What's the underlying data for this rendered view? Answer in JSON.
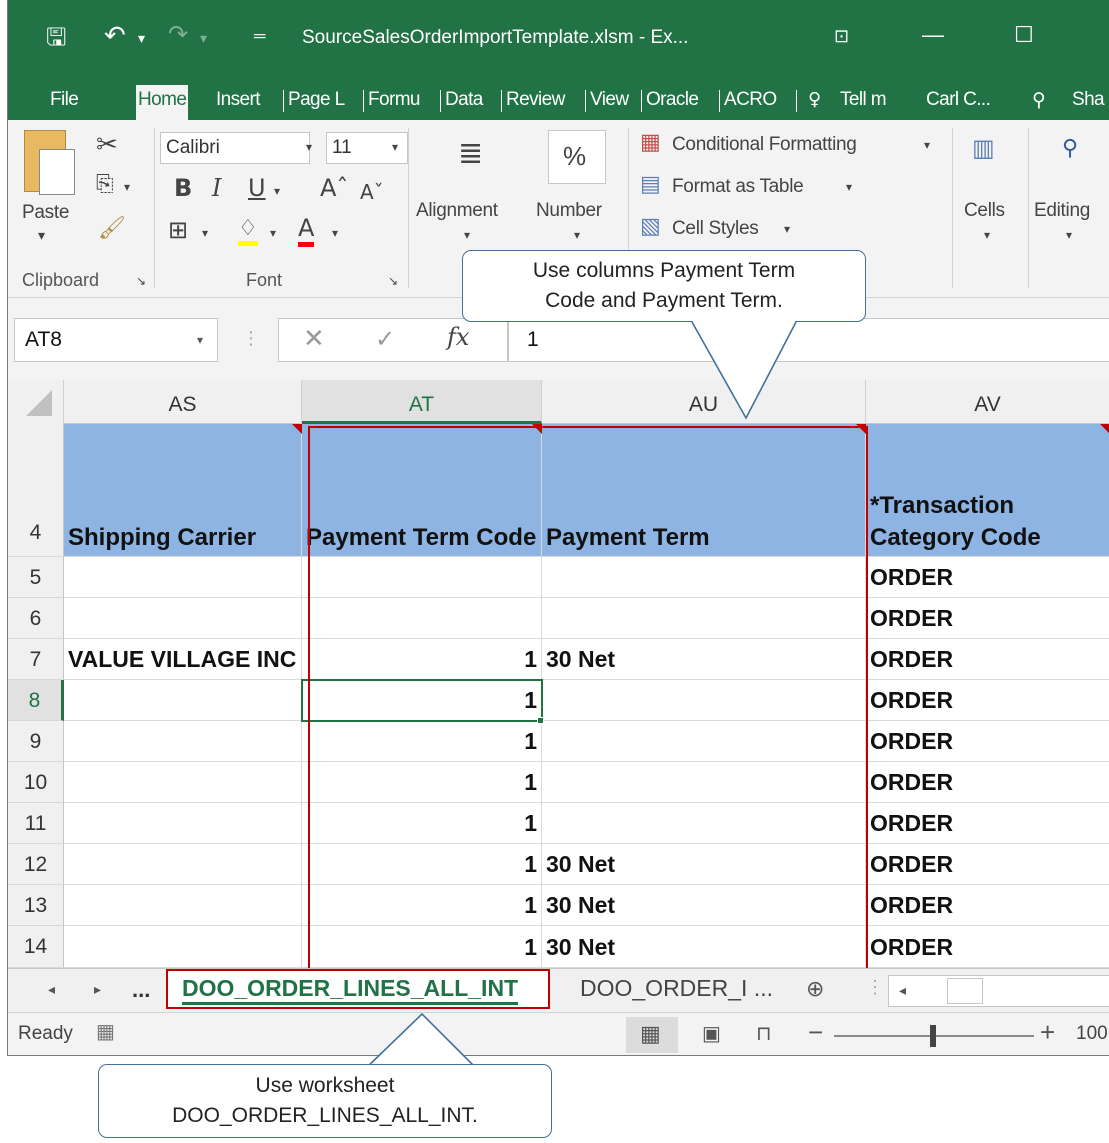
{
  "window": {
    "title": "SourceSalesOrderImportTemplate.xlsm  -  Ex...",
    "user": "Carl C...",
    "share_label": "Sha"
  },
  "ribbon_tabs": [
    "File",
    "Home",
    "Insert",
    "Page L",
    "Formu",
    "Data",
    "Review",
    "View",
    "Oracle",
    "ACRO"
  ],
  "tell_me": "Tell m",
  "ribbon": {
    "clipboard": {
      "paste_label": "Paste",
      "group_label": "Clipboard"
    },
    "font": {
      "font_name": "Calibri",
      "font_size": "11",
      "group_label": "Font"
    },
    "alignment_label": "Alignment",
    "number_label": "Number",
    "styles": {
      "conditional_formatting": "Conditional Formatting",
      "format_as_table": "Format as Table",
      "cell_styles": "Cell Styles"
    },
    "cells_label": "Cells",
    "editing_label": "Editing"
  },
  "formula_bar": {
    "name_box": "AT8",
    "formula": "1"
  },
  "columns": [
    "AS",
    "AT",
    "AU",
    "AV"
  ],
  "header_row": {
    "row_number": "4",
    "cells": [
      "Shipping Carrier",
      "Payment Term Code",
      "Payment Term",
      "*Transaction Category Code"
    ]
  },
  "rows": [
    {
      "row": "5",
      "cells": [
        "",
        "",
        "",
        "ORDER"
      ]
    },
    {
      "row": "6",
      "cells": [
        "",
        "",
        "",
        "ORDER"
      ]
    },
    {
      "row": "7",
      "cells": [
        "VALUE VILLAGE INC",
        "1",
        "30 Net",
        "ORDER"
      ]
    },
    {
      "row": "8",
      "cells": [
        "",
        "1",
        "",
        "ORDER"
      ]
    },
    {
      "row": "9",
      "cells": [
        "",
        "1",
        "",
        "ORDER"
      ]
    },
    {
      "row": "10",
      "cells": [
        "",
        "1",
        "",
        "ORDER"
      ]
    },
    {
      "row": "11",
      "cells": [
        "",
        "1",
        "",
        "ORDER"
      ]
    },
    {
      "row": "12",
      "cells": [
        "",
        "1",
        "30 Net",
        "ORDER"
      ]
    },
    {
      "row": "13",
      "cells": [
        "",
        "1",
        "30 Net",
        "ORDER"
      ]
    },
    {
      "row": "14",
      "cells": [
        "",
        "1",
        "30 Net",
        "ORDER"
      ]
    }
  ],
  "sheet_tabs": {
    "ellipsis": "...",
    "active": "DOO_ORDER_LINES_ALL_INT",
    "next": "DOO_ORDER_I ..."
  },
  "status": {
    "ready": "Ready",
    "zoom": "100"
  },
  "callouts": {
    "columns_line1": "Use columns Payment Term",
    "columns_line2": "Code and Payment Term.",
    "worksheet_line1": "Use worksheet",
    "worksheet_line2": "DOO_ORDER_LINES_ALL_INT."
  },
  "colors": {
    "excel_green": "#217346",
    "header_blue": "#8db4e2",
    "highlight_red": "#c00000"
  }
}
